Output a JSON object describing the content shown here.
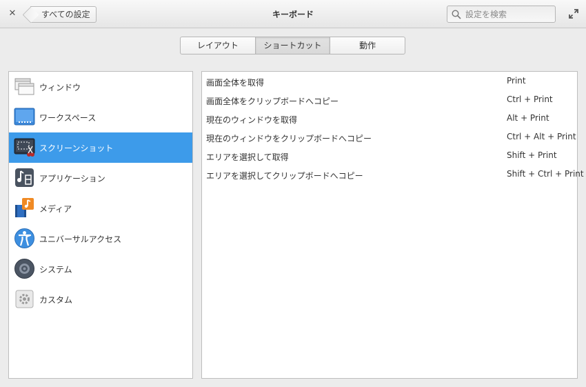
{
  "header": {
    "close_icon": "close-icon",
    "back_label": "すべての設定",
    "title": "キーボード",
    "search_placeholder": "設定を検索",
    "maximize_icon": "maximize-icon"
  },
  "tabs": [
    {
      "label": "レイアウト",
      "active": false
    },
    {
      "label": "ショートカット",
      "active": true
    },
    {
      "label": "動作",
      "active": false
    }
  ],
  "sidebar": {
    "items": [
      {
        "label": "ウィンドウ",
        "icon": "window-icon",
        "selected": false
      },
      {
        "label": "ワークスペース",
        "icon": "workspace-icon",
        "selected": false
      },
      {
        "label": "スクリーンショット",
        "icon": "screenshot-icon",
        "selected": true
      },
      {
        "label": "アプリケーション",
        "icon": "applications-icon",
        "selected": false
      },
      {
        "label": "メディア",
        "icon": "media-icon",
        "selected": false
      },
      {
        "label": "ユニバーサルアクセス",
        "icon": "accessibility-icon",
        "selected": false
      },
      {
        "label": "システム",
        "icon": "system-icon",
        "selected": false
      },
      {
        "label": "カスタム",
        "icon": "custom-icon",
        "selected": false
      }
    ]
  },
  "shortcuts": [
    {
      "name": "画面全体を取得",
      "keys": "Print"
    },
    {
      "name": "画面全体をクリップボードへコピー",
      "keys": "Ctrl + Print"
    },
    {
      "name": "現在のウィンドウを取得",
      "keys": "Alt + Print"
    },
    {
      "name": "現在のウィンドウをクリップボードへコピー",
      "keys": "Ctrl + Alt + Print"
    },
    {
      "name": "エリアを選択して取得",
      "keys": "Shift + Print"
    },
    {
      "name": "エリアを選択してクリップボードへコピー",
      "keys": "Shift + Ctrl + Print"
    }
  ],
  "colors": {
    "selection": "#3d9bea",
    "background": "#ececec"
  }
}
